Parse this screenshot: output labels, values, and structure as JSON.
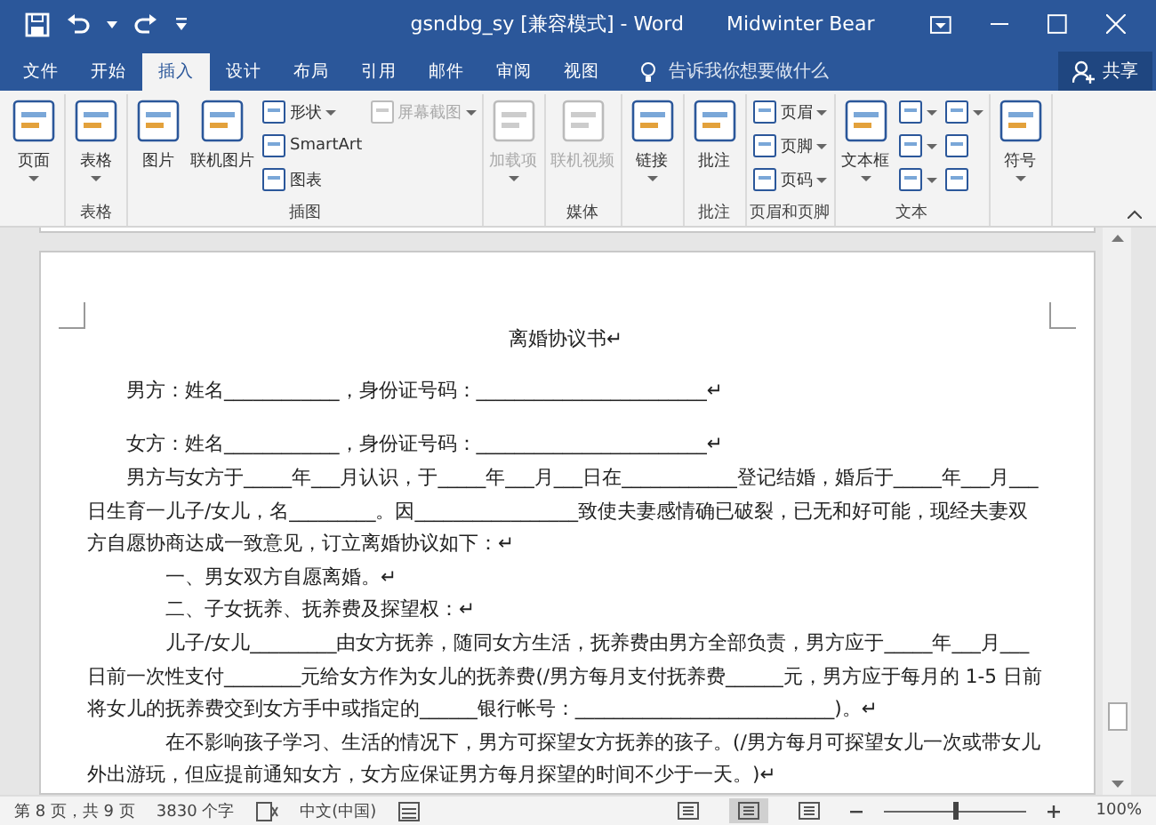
{
  "window": {
    "title": "gsndbg_sy [兼容模式]  -  Word",
    "user": "Midwinter Bear"
  },
  "tabs": [
    {
      "label": "文件",
      "selected": false
    },
    {
      "label": "开始",
      "selected": false
    },
    {
      "label": "插入",
      "selected": true
    },
    {
      "label": "设计",
      "selected": false
    },
    {
      "label": "布局",
      "selected": false
    },
    {
      "label": "引用",
      "selected": false
    },
    {
      "label": "邮件",
      "selected": false
    },
    {
      "label": "审阅",
      "selected": false
    },
    {
      "label": "视图",
      "selected": false
    }
  ],
  "tell_me": {
    "placeholder": "告诉我你想要做什么"
  },
  "share_button": "共享",
  "ribbon_groups": [
    {
      "buttons": [
        {
          "label": "页面",
          "kind": "large",
          "disabled": false,
          "dropdown": true
        }
      ]
    },
    {
      "label": "表格",
      "buttons": [
        {
          "label": "表格",
          "kind": "large",
          "disabled": false,
          "dropdown": true
        }
      ]
    },
    {
      "label": "插图",
      "buttons": [
        {
          "label": "图片",
          "kind": "large",
          "disabled": false,
          "dropdown": false
        },
        {
          "label": "联机图片",
          "kind": "large",
          "disabled": false,
          "dropdown": false
        },
        {
          "label": "形状",
          "kind": "small",
          "disabled": false,
          "dropdown": true
        },
        {
          "label": "SmartArt",
          "kind": "small",
          "disabled": false,
          "dropdown": false
        },
        {
          "label": "图表",
          "kind": "small",
          "disabled": false,
          "dropdown": false
        },
        {
          "label": "屏幕截图",
          "kind": "small",
          "disabled": true,
          "dropdown": true
        }
      ]
    },
    {
      "buttons": [
        {
          "label": "加载项",
          "kind": "large",
          "disabled": true,
          "dropdown": true
        }
      ]
    },
    {
      "label": "媒体",
      "buttons": [
        {
          "label": "联机视频",
          "kind": "large",
          "disabled": true,
          "dropdown": false
        }
      ]
    },
    {
      "buttons": [
        {
          "label": "链接",
          "kind": "large",
          "disabled": false,
          "dropdown": true
        }
      ]
    },
    {
      "label": "批注",
      "buttons": [
        {
          "label": "批注",
          "kind": "large",
          "disabled": false,
          "dropdown": false
        }
      ]
    },
    {
      "label": "页眉和页脚",
      "buttons": [
        {
          "label": "页眉",
          "kind": "small",
          "disabled": false,
          "dropdown": true
        },
        {
          "label": "页脚",
          "kind": "small",
          "disabled": false,
          "dropdown": true
        },
        {
          "label": "页码",
          "kind": "small",
          "disabled": false,
          "dropdown": true
        }
      ]
    },
    {
      "label": "文本",
      "buttons": [
        {
          "label": "文本框",
          "kind": "large",
          "disabled": false,
          "dropdown": true
        },
        {
          "kind": "icon",
          "disabled": false,
          "dropdown": true
        },
        {
          "kind": "icon",
          "disabled": false,
          "dropdown": true
        },
        {
          "kind": "icon",
          "disabled": false,
          "dropdown": true
        },
        {
          "kind": "icon",
          "disabled": false,
          "dropdown": true
        },
        {
          "kind": "icon",
          "disabled": false,
          "dropdown": false
        },
        {
          "kind": "icon",
          "disabled": false,
          "dropdown": false
        }
      ]
    },
    {
      "buttons": [
        {
          "label": "符号",
          "kind": "large",
          "disabled": false,
          "dropdown": true
        }
      ]
    }
  ],
  "document": {
    "paragraphs": [
      {
        "kind": "title",
        "text": "离婚协议书↵"
      },
      {
        "kind": "body",
        "text": "男方：姓名____________，身份证号码：________________________↵"
      },
      {
        "kind": "gap"
      },
      {
        "kind": "body",
        "text": "女方：姓名____________，身份证号码：________________________↵"
      },
      {
        "kind": "body",
        "text": "男方与女方于_____年___月认识，于_____年___月___日在____________登记结婚，婚后于_____年___月___日生育一儿子/女儿，名_________。因_________________致使夫妻感情确已破裂，已无和好可能，现经夫妻双方自愿协商达成一致意见，订立离婚协议如下：↵"
      },
      {
        "kind": "item",
        "text": "一、男女双方自愿离婚。↵"
      },
      {
        "kind": "item",
        "text": "二、子女抚养、抚养费及探望权：↵"
      },
      {
        "kind": "item",
        "text": "儿子/女儿_________由女方抚养，随同女方生活，抚养费由男方全部负责，男方应于_____年___月___日前一次性支付________元给女方作为女儿的抚养费(/男方每月支付抚养费______元，男方应于每月的 1-5 日前将女儿的抚养费交到女方手中或指定的______银行帐号：___________________________)。↵"
      },
      {
        "kind": "item",
        "text": "在不影响孩子学习、生活的情况下，男方可探望女方抚养的孩子。(/男方每月可探望女儿一次或带女儿外出游玩，但应提前通知女方，女方应保证男方每月探望的时间不少于一天。)↵"
      }
    ]
  },
  "status_bar": {
    "page": "第 8 页，共 9 页",
    "words": "3830 个字",
    "language": "中文(中国)",
    "views": [
      {
        "selected": false
      },
      {
        "selected": true
      },
      {
        "selected": false
      }
    ],
    "zoom": {
      "level": 0.5,
      "reading": "100%"
    }
  }
}
